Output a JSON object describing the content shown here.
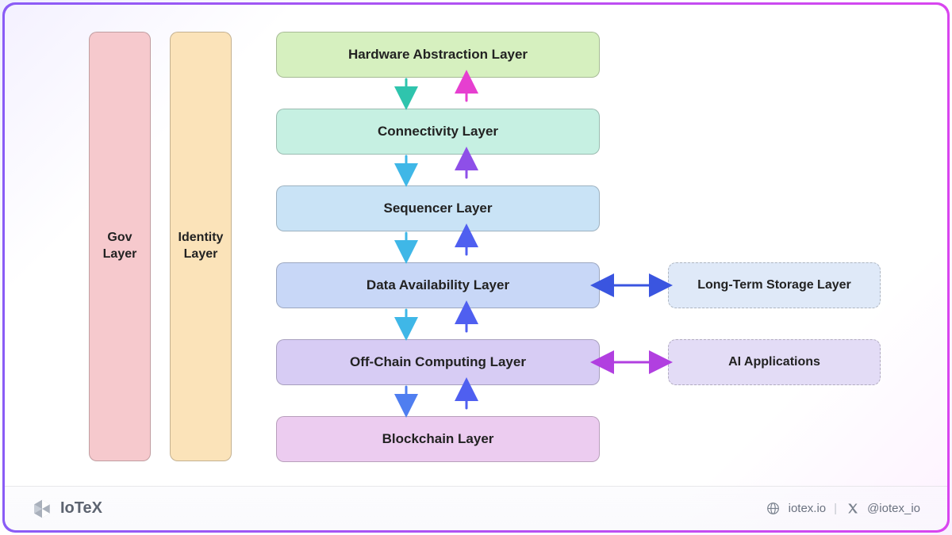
{
  "pillars": {
    "gov": "Gov\nLayer",
    "identity": "Identity\nLayer"
  },
  "stack": {
    "hardware": "Hardware Abstraction Layer",
    "connectivity": "Connectivity Layer",
    "sequencer": "Sequencer Layer",
    "data_avail": "Data Availability Layer",
    "offchain": "Off-Chain Computing Layer",
    "blockchain": "Blockchain Layer"
  },
  "side": {
    "storage": "Long-Term Storage Layer",
    "ai": "AI Applications"
  },
  "colors": {
    "gov": "#f6c9cd",
    "identity": "#fbe3b9",
    "hardware": "#d6f0bf",
    "connectivity": "#c6f0e2",
    "sequencer": "#c9e3f6",
    "data_avail": "#c8d7f7",
    "offchain": "#d7ccf4",
    "blockchain": "#ecccf0",
    "storage": "#dfe9f8",
    "ai": "#e3dcf6",
    "arrow_down_teal": "#2fc4ad",
    "arrow_down_cyan": "#3fb7e7",
    "arrow_down_blue": "#4f7ef0",
    "arrow_up_magenta": "#e63fd0",
    "arrow_up_purple": "#8e4fe8",
    "arrow_up_blue": "#4f5ff0",
    "arrow_side_blue": "#3a55e0",
    "arrow_side_mag": "#b13fe0"
  },
  "footer": {
    "brand": "IoTeX",
    "site": "iotex.io",
    "handle": "@iotex_io"
  }
}
